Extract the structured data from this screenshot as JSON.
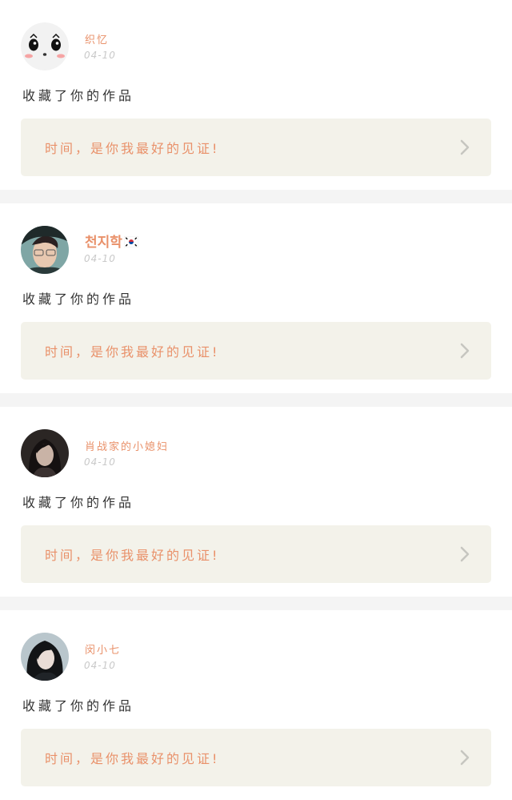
{
  "notifications": [
    {
      "username": "织忆",
      "date": "04-10",
      "action": "收藏了你的作品",
      "quote": "时间，是你我最好的见证!",
      "avatar_icon": "cartoon-face-avatar"
    },
    {
      "username": "천지학",
      "date": "04-10",
      "action": "收藏了你的作品",
      "quote": "时间，是你我最好的见证!",
      "avatar_icon": "man-portrait-avatar"
    },
    {
      "username": "肖战家的小媳妇",
      "date": "04-10",
      "action": "收藏了你的作品",
      "quote": "时间，是你我最好的见证!",
      "avatar_icon": "woman-portrait-avatar"
    },
    {
      "username": "闵小七",
      "date": "04-10",
      "action": "收藏了你的作品",
      "quote": "时间，是你我最好的见证!",
      "avatar_icon": "girl-portrait-avatar"
    }
  ],
  "colors": {
    "accent": "#e9916a",
    "quote_bg": "#f3f2ea",
    "date": "#c9c9c9",
    "text": "#333333",
    "divider": "#f4f4f4"
  }
}
